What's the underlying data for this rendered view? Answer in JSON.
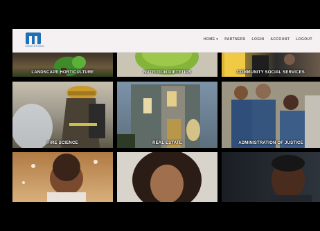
{
  "brand": {
    "logo_text": "MIDDLETOWN"
  },
  "nav": {
    "items": [
      {
        "label": "HOME ▾"
      },
      {
        "label": "PARTNERS"
      },
      {
        "label": "LOGIN"
      },
      {
        "label": "ACCOUNT"
      },
      {
        "label": "LOGOUT"
      }
    ]
  },
  "tiles": [
    {
      "label": "LANDSCAPE HORTICULTURE"
    },
    {
      "label": "NUTRITION DIETETICS"
    },
    {
      "label": "COMMUNITY SOCIAL SERVICES"
    },
    {
      "label": "FIRE SCIENCE"
    },
    {
      "label": "REAL ESTATE"
    },
    {
      "label": "ADMINISTRATION OF JUSTICE"
    },
    {
      "label": ""
    },
    {
      "label": ""
    },
    {
      "label": ""
    }
  ]
}
